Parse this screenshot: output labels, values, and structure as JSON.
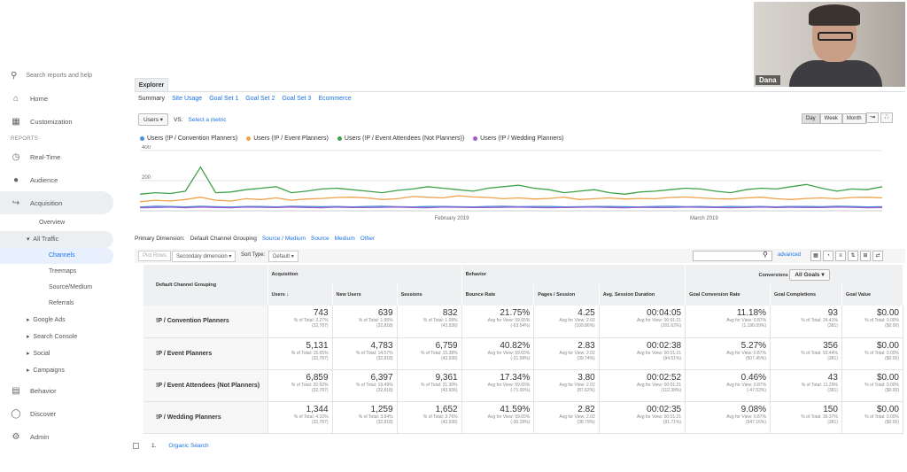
{
  "video": {
    "participant": "Dana"
  },
  "sidebar": {
    "search_placeholder": "Search reports and help",
    "items": [
      {
        "label": "Home",
        "icon": "home-icon"
      },
      {
        "label": "Customization",
        "icon": "dashboard-icon"
      }
    ],
    "reports_section": "REPORTS",
    "reports": [
      {
        "label": "Real-Time",
        "icon": "clock-icon"
      },
      {
        "label": "Audience",
        "icon": "person-icon"
      },
      {
        "label": "Acquisition",
        "icon": "acquisition-icon"
      }
    ],
    "acquisition_sub": {
      "overview": "Overview",
      "all_traffic": "All Traffic",
      "all_traffic_children": [
        "Channels",
        "Treemaps",
        "Source/Medium",
        "Referrals"
      ],
      "others": [
        "Google Ads",
        "Search Console",
        "Social",
        "Campaigns"
      ]
    },
    "behavior": "Behavior",
    "discover": "Discover",
    "admin": "Admin"
  },
  "explorer": {
    "tab": "Explorer",
    "subtabs": [
      "Summary",
      "Site Usage",
      "Goal Set 1",
      "Goal Set 2",
      "Goal Set 3",
      "Ecommerce"
    ],
    "metric_select": "Users",
    "vs": "VS.",
    "select_metric": "Select a metric",
    "range_buttons": [
      "Day",
      "Week",
      "Month"
    ]
  },
  "legend": [
    {
      "label": "Users (!P / Convention Planners)",
      "color": "#4a90d9"
    },
    {
      "label": "Users (!P / Event Planners)",
      "color": "#f0a24a"
    },
    {
      "label": "Users (!P / Event Attendees (Not Planners))",
      "color": "#3ea24a"
    },
    {
      "label": "Users (!P / Wedding Planners)",
      "color": "#9c5fc9"
    }
  ],
  "chart_data": {
    "type": "line",
    "ytick_labels": [
      "400",
      "200"
    ],
    "ylim": [
      0,
      400
    ],
    "xtick_labels": [
      "February 2019",
      "March 2019"
    ],
    "series": [
      {
        "name": "Users (!P / Convention Planners)",
        "color": "#4a90d9",
        "values": [
          25,
          30,
          28,
          26,
          30,
          27,
          25,
          29,
          28,
          26,
          30,
          28,
          27,
          29,
          26,
          28,
          30,
          27,
          26,
          28,
          29,
          27,
          26,
          28,
          30,
          27,
          29,
          28,
          26,
          27,
          29,
          28,
          27,
          26,
          28,
          30,
          27,
          28,
          26,
          29,
          27,
          28,
          26,
          29,
          28,
          27,
          30,
          28,
          26,
          27
        ]
      },
      {
        "name": "Users (!P / Event Planners)",
        "color": "#f0a24a",
        "values": [
          60,
          70,
          65,
          75,
          90,
          70,
          65,
          80,
          75,
          85,
          70,
          78,
          82,
          88,
          90,
          85,
          75,
          80,
          95,
          90,
          85,
          100,
          92,
          88,
          80,
          85,
          78,
          82,
          90,
          75,
          80,
          85,
          78,
          82,
          80,
          88,
          92,
          85,
          80,
          78,
          85,
          90,
          80,
          75,
          82,
          85,
          80,
          88,
          90,
          85
        ]
      },
      {
        "name": "Users (!P / Event Attendees (Not Planners))",
        "color": "#3ea24a",
        "values": [
          110,
          120,
          115,
          130,
          290,
          120,
          125,
          140,
          150,
          160,
          120,
          130,
          145,
          150,
          140,
          130,
          120,
          135,
          145,
          160,
          150,
          140,
          130,
          150,
          160,
          170,
          150,
          140,
          120,
          130,
          140,
          120,
          110,
          125,
          130,
          140,
          150,
          145,
          130,
          120,
          140,
          150,
          145,
          160,
          175,
          150,
          130,
          145,
          140,
          160
        ]
      },
      {
        "name": "Users (!P / Wedding Planners)",
        "color": "#9c5fc9",
        "values": [
          20,
          22,
          24,
          20,
          25,
          22,
          20,
          24,
          23,
          21,
          25,
          22,
          20,
          24,
          22,
          21,
          23,
          25,
          22,
          20,
          24,
          23,
          22,
          21,
          23,
          24,
          22,
          20,
          21,
          23,
          24,
          22,
          20,
          23,
          22,
          21,
          24,
          23,
          22,
          20,
          21,
          24,
          22,
          23,
          21,
          22,
          24,
          23,
          20,
          22
        ]
      }
    ]
  },
  "primary_dimension": {
    "label": "Primary Dimension:",
    "current": "Default Channel Grouping",
    "options": [
      "Source / Medium",
      "Source",
      "Medium",
      "Other"
    ]
  },
  "toolbar": {
    "plot_rows": "Plot Rows",
    "secondary": "Secondary dimension",
    "sort_type": "Sort Type:",
    "sort_value": "Default",
    "advanced": "advanced"
  },
  "table": {
    "group_header": "Default Channel Grouping",
    "acquisition": "Acquisition",
    "behavior": "Behavior",
    "conversions": "Conversions",
    "all_goals": "All Goals",
    "goal_completions": "Goal Completions",
    "columns": [
      "Users",
      "New Users",
      "Sessions",
      "Bounce Rate",
      "Pages / Session",
      "Avg. Session Duration",
      "Goal Conversion Rate",
      "Goal Completions",
      "Goal Value"
    ],
    "rows": [
      {
        "name": "!P / Convention Planners",
        "cells": [
          [
            "743",
            "% of Total: 2.27%",
            "(32,787)"
          ],
          [
            "639",
            "% of Total: 1.95%",
            "(32,818)"
          ],
          [
            "832",
            "% of Total: 1.09%",
            "(43,936)"
          ],
          [
            "21.75%",
            "Avg for View: 59.65%",
            "(-63.54%)"
          ],
          [
            "4.25",
            "Avg for View: 2.02",
            "(109.86%)"
          ],
          [
            "00:04:05",
            "Avg for View: 00:01:21",
            "(201.62%)"
          ],
          [
            "11.18%",
            "Avg for View: 0.87%",
            "(1,190.09%)"
          ],
          [
            "93",
            "% of Total: 24.41%",
            "(381)"
          ],
          [
            "$0.00",
            "% of Total: 0.00%",
            "($0.00)"
          ]
        ]
      },
      {
        "name": "!P / Event Planners",
        "cells": [
          [
            "5,131",
            "% of Total: 15.65%",
            "(32,787)"
          ],
          [
            "4,783",
            "% of Total: 14.57%",
            "(32,818)"
          ],
          [
            "6,759",
            "% of Total: 15.38%",
            "(43,936)"
          ],
          [
            "40.82%",
            "Avg for View: 59.65%",
            "(-31.58%)"
          ],
          [
            "2.83",
            "Avg for View: 2.02",
            "(39.74%)"
          ],
          [
            "00:02:38",
            "Avg for View: 00:01:21",
            "(94.51%)"
          ],
          [
            "5.27%",
            "Avg for View: 0.87%",
            "(507.45%)"
          ],
          [
            "356",
            "% of Total: 93.44%",
            "(381)"
          ],
          [
            "$0.00",
            "% of Total: 0.00%",
            "($0.00)"
          ]
        ]
      },
      {
        "name": "!P / Event Attendees (Not Planners)",
        "cells": [
          [
            "6,859",
            "% of Total: 20.92%",
            "(32,787)"
          ],
          [
            "6,397",
            "% of Total: 19.49%",
            "(32,818)"
          ],
          [
            "9,361",
            "% of Total: 21.30%",
            "(43,936)"
          ],
          [
            "17.34%",
            "Avg for View: 59.65%",
            "(-71.00%)"
          ],
          [
            "3.80",
            "Avg for View: 2.02",
            "(87.62%)"
          ],
          [
            "00:02:52",
            "Avg for View: 00:01:21",
            "(112.38%)"
          ],
          [
            "0.46%",
            "Avg for View: 0.87%",
            "(-47.02%)"
          ],
          [
            "43",
            "% of Total: 11.29%",
            "(381)"
          ],
          [
            "$0.00",
            "% of Total: 0.00%",
            "($0.00)"
          ]
        ]
      },
      {
        "name": "!P / Wedding Planners",
        "cells": [
          [
            "1,344",
            "% of Total: 4.10%",
            "(32,787)"
          ],
          [
            "1,259",
            "% of Total: 3.84%",
            "(32,818)"
          ],
          [
            "1,652",
            "% of Total: 3.76%",
            "(43,936)"
          ],
          [
            "41.59%",
            "Avg for View: 59.65%",
            "(-30.28%)"
          ],
          [
            "2.82",
            "Avg for View: 2.02",
            "(38.79%)"
          ],
          [
            "00:02:35",
            "Avg for View: 00:01:21",
            "(91.71%)"
          ],
          [
            "9.08%",
            "Avg for View: 0.87%",
            "(947.16%)"
          ],
          [
            "150",
            "% of Total: 39.37%",
            "(381)"
          ],
          [
            "$0.00",
            "% of Total: 0.00%",
            "($0.00)"
          ]
        ]
      }
    ],
    "next_row": {
      "index": "1.",
      "label": "Organic Search"
    }
  }
}
